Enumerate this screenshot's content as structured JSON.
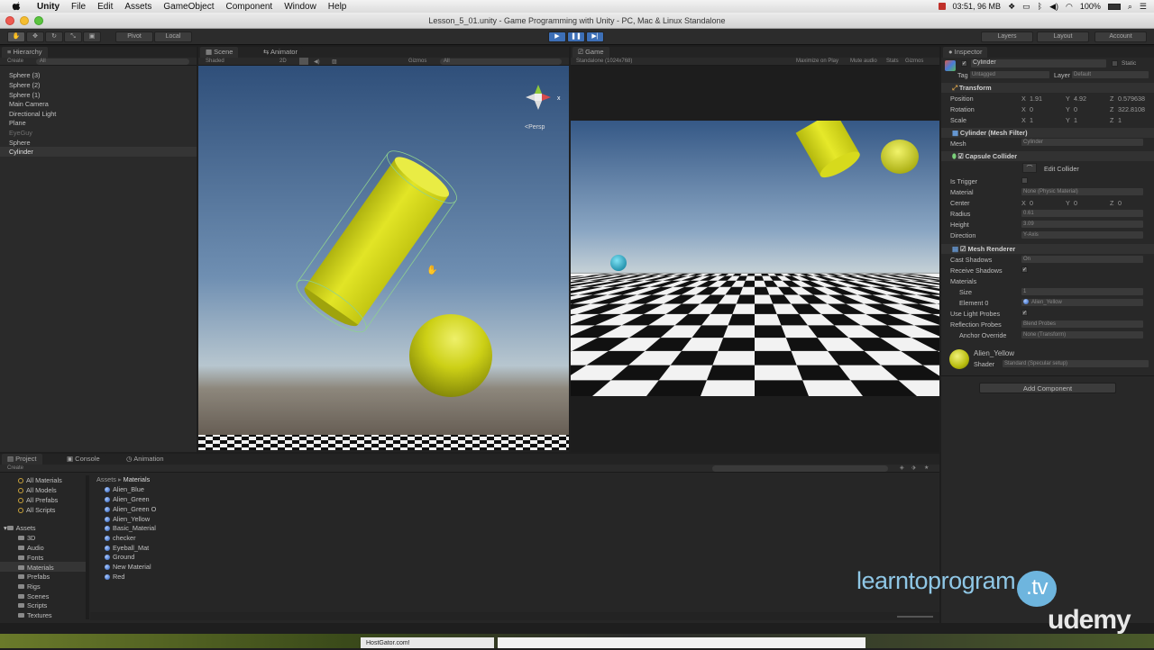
{
  "menubar": {
    "app": "Unity",
    "items": [
      "File",
      "Edit",
      "Assets",
      "GameObject",
      "Component",
      "Window",
      "Help"
    ],
    "status": "03:51, 96 MB",
    "battery": "100%"
  },
  "window_title": "Lesson_5_01.unity - Game Programming with Unity - PC, Mac & Linux Standalone",
  "toolbar": {
    "pivot": "Pivot",
    "local": "Local",
    "layers": "Layers",
    "layout": "Layout",
    "account": "Account"
  },
  "hierarchy": {
    "tab": "Hierarchy",
    "create": "Create",
    "search": "All",
    "items": [
      "Sphere (3)",
      "Sphere (2)",
      "Sphere (1)",
      "Main Camera",
      "Directional Light",
      "Plane",
      "EyeGuy",
      "Sphere",
      "Cylinder"
    ]
  },
  "scene": {
    "tab": "Scene",
    "animator_tab": "Animator",
    "shaded": "Shaded",
    "mode2d": "2D",
    "gizmos": "Gizmos",
    "search": "All",
    "persp": "Persp"
  },
  "game": {
    "tab": "Game",
    "resolution": "Standalone (1024x768)",
    "maximize": "Maximize on Play",
    "mute": "Mute audio",
    "stats": "Stats",
    "gizmos": "Gizmos"
  },
  "inspector": {
    "tab": "Inspector",
    "object_name": "Cylinder",
    "static": "Static",
    "tag_label": "Tag",
    "tag_value": "Untagged",
    "layer_label": "Layer",
    "layer_value": "Default",
    "transform": {
      "title": "Transform",
      "position_label": "Position",
      "position": {
        "x": "1.91",
        "y": "4.92",
        "z": "0.579638"
      },
      "rotation_label": "Rotation",
      "rotation": {
        "x": "0",
        "y": "0",
        "z": "322.8108"
      },
      "scale_label": "Scale",
      "scale": {
        "x": "1",
        "y": "1",
        "z": "1"
      }
    },
    "mesh_filter": {
      "title": "Cylinder (Mesh Filter)",
      "mesh_label": "Mesh",
      "mesh_value": "Cylinder"
    },
    "capsule": {
      "title": "Capsule Collider",
      "edit": "Edit Collider",
      "is_trigger": "Is Trigger",
      "material_label": "Material",
      "material_value": "None (Physic Material)",
      "center_label": "Center",
      "center": {
        "x": "0",
        "y": "0",
        "z": "0"
      },
      "radius_label": "Radius",
      "radius": "0.61",
      "height_label": "Height",
      "height": "3.09",
      "direction_label": "Direction",
      "direction": "Y-Axis"
    },
    "mesh_renderer": {
      "title": "Mesh Renderer",
      "cast_label": "Cast Shadows",
      "cast": "On",
      "receive_label": "Receive Shadows",
      "materials_label": "Materials",
      "size_label": "Size",
      "size": "1",
      "element_label": "Element 0",
      "element": "Alien_Yellow",
      "light_probes_label": "Use Light Probes",
      "reflection_label": "Reflection Probes",
      "reflection": "Blend Probes",
      "anchor_label": "Anchor Override",
      "anchor": "None (Transform)"
    },
    "material": {
      "name": "Alien_Yellow",
      "shader_label": "Shader",
      "shader": "Standard (Specular setup)"
    },
    "add_component": "Add Component"
  },
  "project": {
    "tabs": [
      "Project",
      "Console",
      "Animation"
    ],
    "create": "Create",
    "favorites": [
      "All Materials",
      "All Models",
      "All Prefabs",
      "All Scripts"
    ],
    "assets_root": "Assets",
    "folders": [
      "3D",
      "Audio",
      "Fonts",
      "Materials",
      "Prefabs",
      "Rigs",
      "Scenes",
      "Scripts",
      "Textures"
    ],
    "breadcrumb": [
      "Assets",
      "Materials"
    ],
    "files": [
      "Alien_Blue",
      "Alien_Green",
      "Alien_Green O",
      "Alien_Yellow",
      "Basic_Material",
      "checker",
      "Eyeball_Mat",
      "Ground",
      "New Material",
      "Red"
    ]
  },
  "watermark": {
    "brand": "learntoprogram",
    "tv": "tv",
    "udemy": "udemy"
  },
  "taskbar": {
    "label": "HostGator.com!"
  },
  "colors": {
    "accent_blue": "#3d6fb6",
    "selection": "#3e5f96",
    "yellow": "#d8dc18"
  }
}
